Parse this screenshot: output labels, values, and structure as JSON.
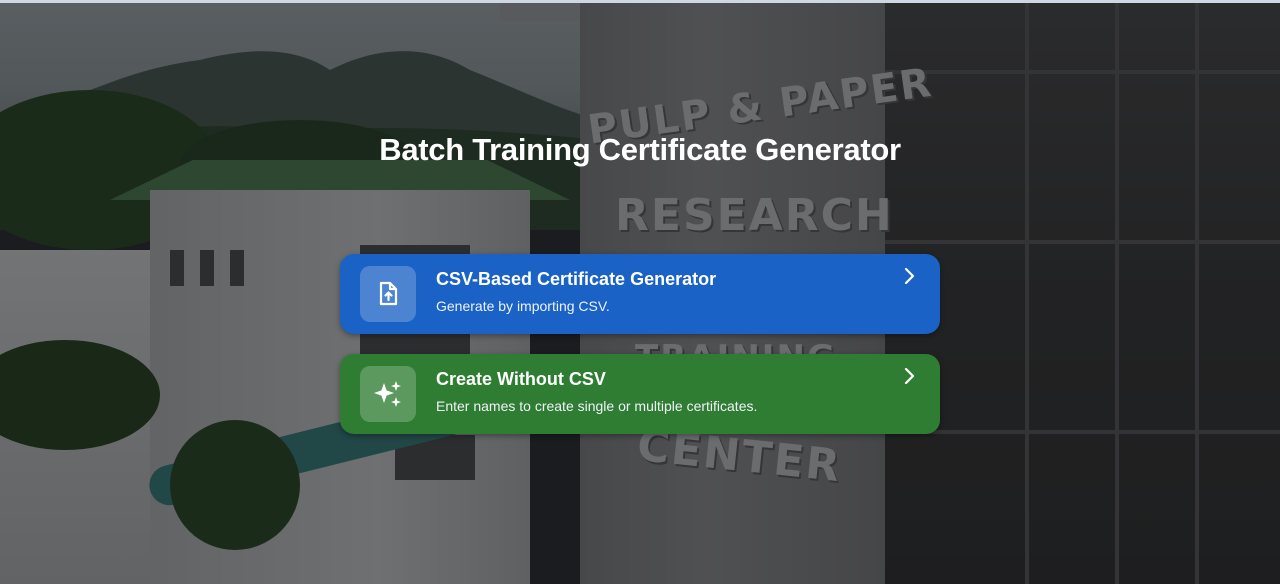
{
  "page": {
    "title": "Batch Training Certificate Generator"
  },
  "background": {
    "sign_lines": [
      "PULP & PAPER",
      "RESEARCH",
      "TRAINING",
      "CENTER"
    ]
  },
  "options": [
    {
      "title": "CSV-Based Certificate Generator",
      "subtitle": "Generate by importing CSV.",
      "icon": "file-upload-icon",
      "color": "#1a62c6"
    },
    {
      "title": "Create Without CSV",
      "subtitle": "Enter names to create single or multiple certificates.",
      "icon": "sparkles-icon",
      "color": "#2f7d32"
    }
  ]
}
